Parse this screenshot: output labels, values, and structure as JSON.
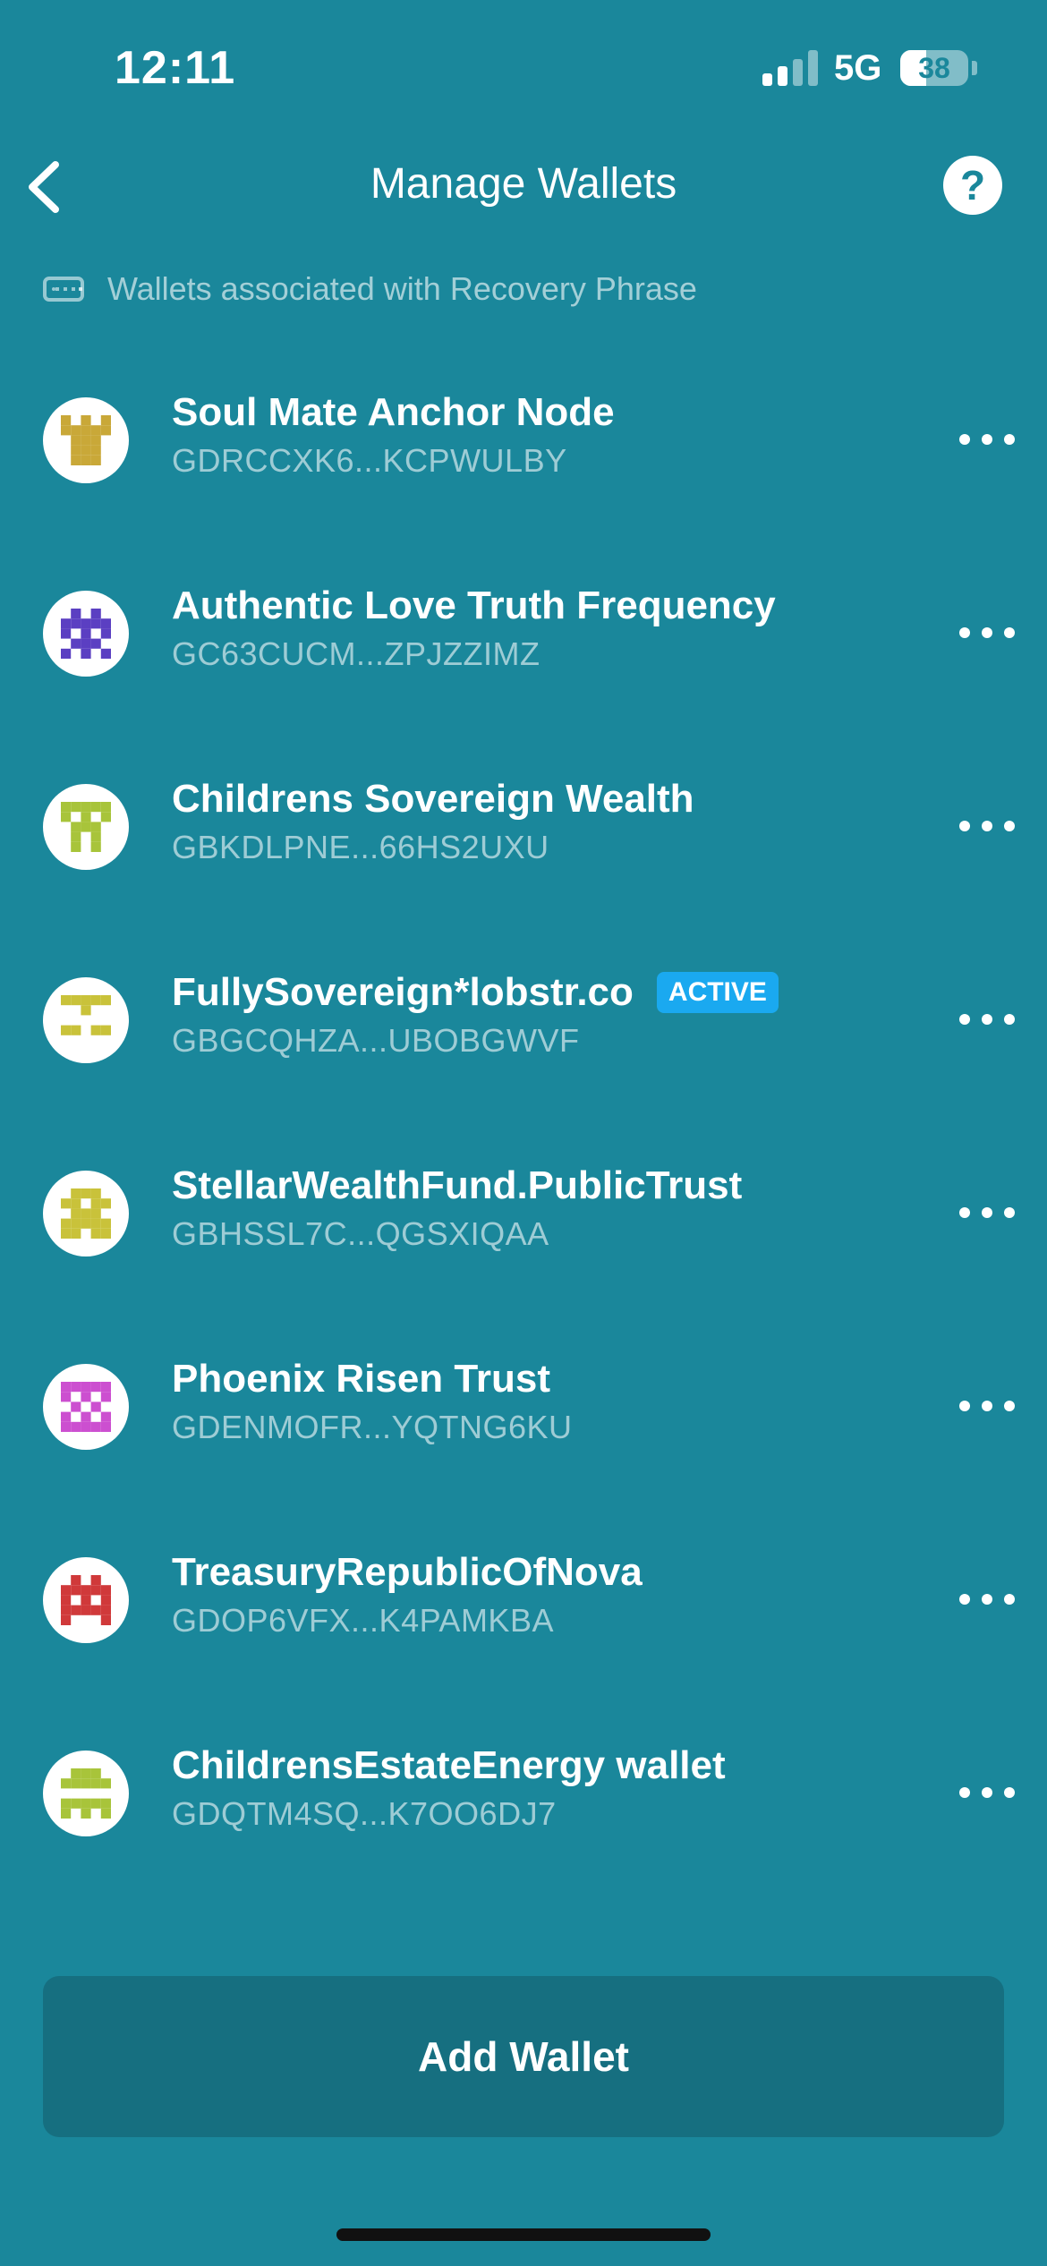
{
  "status_bar": {
    "time": "12:11",
    "network": "5G",
    "battery_percent": "38",
    "battery_level": 0.38,
    "signal_bars_active": 2,
    "signal_bars_total": 4
  },
  "nav": {
    "title": "Manage Wallets",
    "help_label": "?",
    "back_icon": "chevron-left-icon"
  },
  "section": {
    "label": "Wallets associated with Recovery Phrase",
    "icon": "keyboard-icon"
  },
  "wallets": [
    {
      "name": "Soul Mate Anchor Node",
      "address": "GDRCCXK6...KCPWULBY",
      "active": false,
      "avatar_color": "#c9a838"
    },
    {
      "name": "Authentic Love Truth Frequency",
      "address": "GC63CUCM...ZPJZZIMZ",
      "active": false,
      "avatar_color": "#5b3fc2"
    },
    {
      "name": "Childrens Sovereign Wealth",
      "address": "GBKDLPNE...66HS2UXU",
      "active": false,
      "avatar_color": "#a8c43a"
    },
    {
      "name": "FullySovereign*lobstr.co",
      "address": "GBGCQHZA...UBOBGWVF",
      "active": true,
      "avatar_color": "#c9c23a"
    },
    {
      "name": "StellarWealthFund.PublicTrust",
      "address": "GBHSSL7C...QGSXIQAA",
      "active": false,
      "avatar_color": "#c9c23a"
    },
    {
      "name": "Phoenix Risen Trust",
      "address": "GDENMOFR...YQTNG6KU",
      "active": false,
      "avatar_color": "#cc4fd0"
    },
    {
      "name": "TreasuryRepublicOfNova",
      "address": "GDOP6VFX...K4PAMKBA",
      "active": false,
      "avatar_color": "#d0393a"
    },
    {
      "name": "ChildrensEstateEnergy wallet",
      "address": "GDQTM4SQ...K7OO6DJ7",
      "active": false,
      "avatar_color": "#a8c43a"
    }
  ],
  "active_badge": "ACTIVE",
  "add_wallet_label": "Add Wallet",
  "colors": {
    "background": "#1a879b",
    "button": "#166f80",
    "badge": "#1aa9f0"
  }
}
